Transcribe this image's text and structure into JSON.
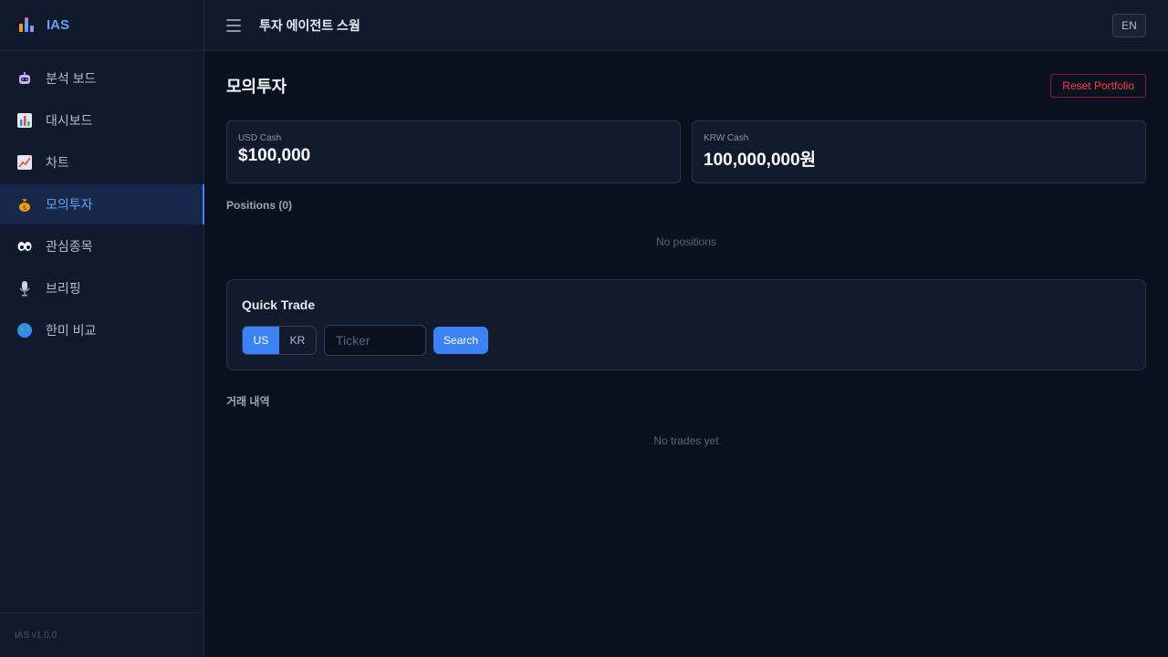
{
  "brand": {
    "name": "IAS"
  },
  "sidebar": {
    "items": [
      {
        "label": "분석 보드",
        "icon": "robot-icon"
      },
      {
        "label": "대시보드",
        "icon": "bar-chart-icon"
      },
      {
        "label": "차트",
        "icon": "line-chart-icon"
      },
      {
        "label": "모의투자",
        "icon": "money-bag-icon",
        "active": true
      },
      {
        "label": "관심종목",
        "icon": "eyes-icon"
      },
      {
        "label": "브리핑",
        "icon": "microphone-icon"
      },
      {
        "label": "한미 비교",
        "icon": "globe-icon"
      }
    ],
    "version": "IAS v1.0.0"
  },
  "topbar": {
    "title": "투자 에이전트 스웜",
    "lang": "EN"
  },
  "page": {
    "title": "모의투자",
    "reset_label": "Reset Portfolio"
  },
  "cash": {
    "usd": {
      "label": "USD Cash",
      "value": "$100,000"
    },
    "krw": {
      "label": "KRW Cash",
      "value": "100,000,000원"
    }
  },
  "positions": {
    "label": "Positions (0)",
    "empty": "No positions"
  },
  "quick_trade": {
    "title": "Quick Trade",
    "markets": [
      "US",
      "KR"
    ],
    "selected_market": "US",
    "ticker_placeholder": "Ticker",
    "ticker_value": "",
    "search_label": "Search"
  },
  "trades": {
    "label": "거래 내역",
    "empty": "No trades yet"
  },
  "colors": {
    "accent": "#3b82f6",
    "danger": "#ef4444",
    "background": "#0c1120",
    "panel": "#111a2c"
  }
}
